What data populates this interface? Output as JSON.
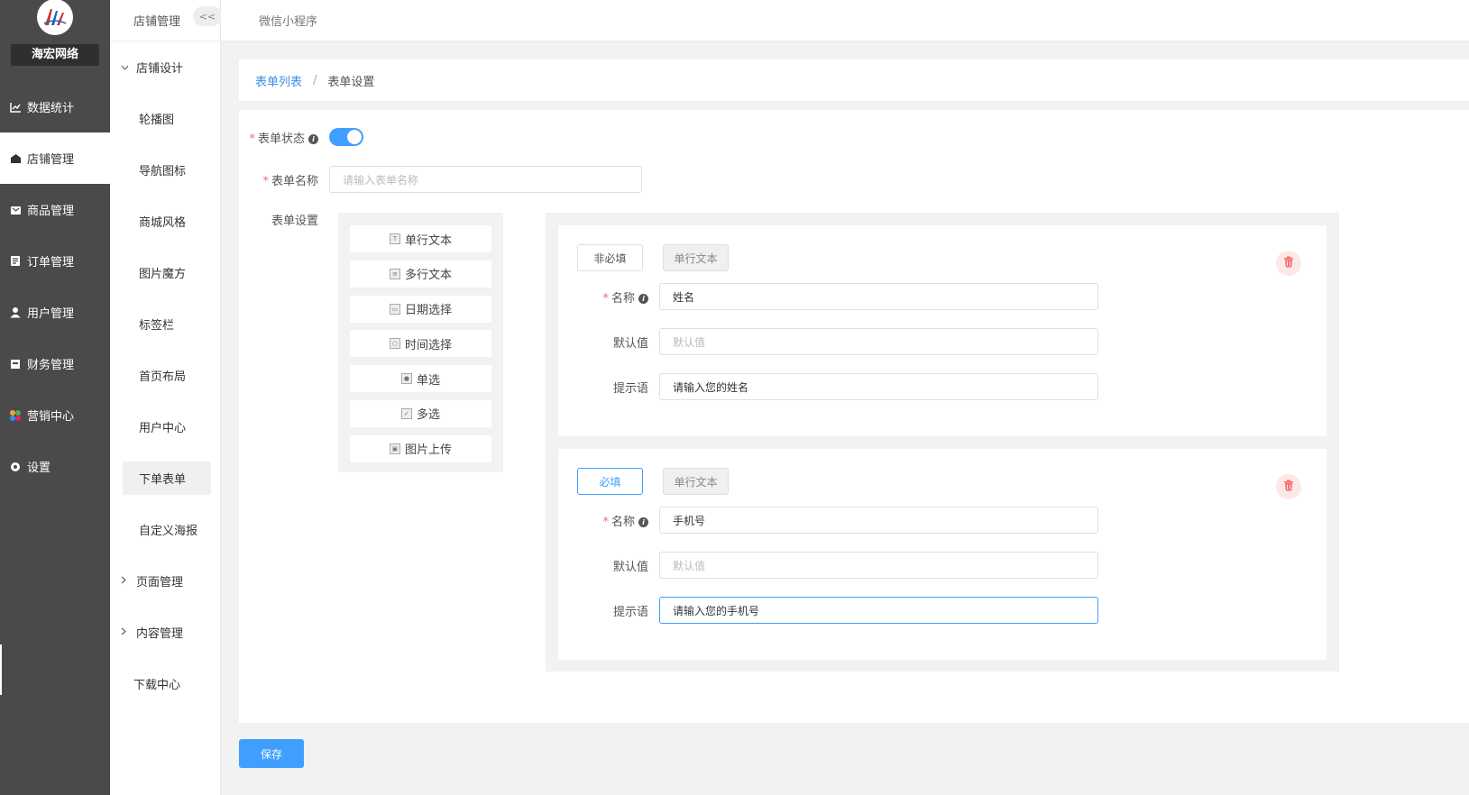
{
  "brand": {
    "name": "海宏网络"
  },
  "sidebar": {
    "items": [
      {
        "label": "数据统计",
        "icon": "chart-icon"
      },
      {
        "label": "店铺管理",
        "icon": "store-icon"
      },
      {
        "label": "商品管理",
        "icon": "goods-icon"
      },
      {
        "label": "订单管理",
        "icon": "order-icon"
      },
      {
        "label": "用户管理",
        "icon": "user-icon"
      },
      {
        "label": "财务管理",
        "icon": "finance-icon"
      },
      {
        "label": "营销中心",
        "icon": "marketing-icon"
      },
      {
        "label": "设置",
        "icon": "settings-icon"
      }
    ]
  },
  "subnav": {
    "title": "店铺管理",
    "collapse_label": "<<",
    "group_design": "店铺设计",
    "items": [
      "轮播图",
      "导航图标",
      "商城风格",
      "图片魔方",
      "标签栏",
      "首页布局",
      "用户中心",
      "下单表单",
      "自定义海报"
    ],
    "group_pages": "页面管理",
    "group_content": "内容管理",
    "download": "下载中心"
  },
  "topbar": {
    "title": "微信小程序"
  },
  "breadcrumb": {
    "parent": "表单列表",
    "separator": "/",
    "current": "表单设置"
  },
  "form": {
    "status_label": "表单状态",
    "status_on": true,
    "name_label": "表单名称",
    "name_placeholder": "请输入表单名称",
    "settings_label": "表单设置",
    "required_mark": "*"
  },
  "palette": [
    {
      "label": "单行文本",
      "icon": "text-line-icon"
    },
    {
      "label": "多行文本",
      "icon": "text-multi-icon"
    },
    {
      "label": "日期选择",
      "icon": "date-icon"
    },
    {
      "label": "时间选择",
      "icon": "time-icon"
    },
    {
      "label": "单选",
      "icon": "radio-icon"
    },
    {
      "label": "多选",
      "icon": "checkbox-icon"
    },
    {
      "label": "图片上传",
      "icon": "image-upload-icon"
    }
  ],
  "cards": [
    {
      "required_label": "非必填",
      "type_label": "单行文本",
      "name_label": "名称",
      "name_value": "姓名",
      "default_label": "默认值",
      "default_placeholder": "默认值",
      "hint_label": "提示语",
      "hint_value": "请输入您的姓名"
    },
    {
      "required_label": "必填",
      "type_label": "单行文本",
      "name_label": "名称",
      "name_value": "手机号",
      "default_label": "默认值",
      "default_placeholder": "默认值",
      "hint_label": "提示语",
      "hint_value": "请输入您的手机号"
    }
  ],
  "actions": {
    "save": "保存"
  },
  "colors": {
    "primary": "#409eff",
    "sidebar_bg": "#4a4a4a",
    "danger": "#f56c6c"
  }
}
